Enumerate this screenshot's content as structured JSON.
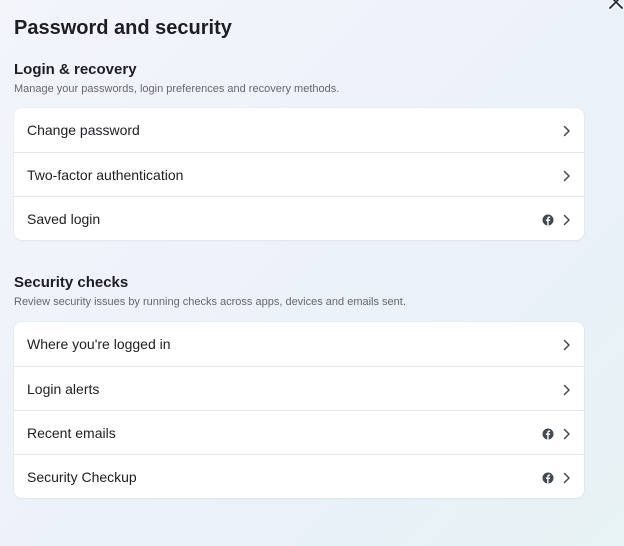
{
  "page": {
    "title": "Password and security"
  },
  "login_recovery": {
    "title": "Login & recovery",
    "description": "Manage your passwords, login preferences and recovery methods.",
    "items": [
      {
        "label": "Change password",
        "meta_icon": false
      },
      {
        "label": "Two-factor authentication",
        "meta_icon": false
      },
      {
        "label": "Saved login",
        "meta_icon": true
      }
    ]
  },
  "security_checks": {
    "title": "Security checks",
    "description": "Review security issues by running checks across apps, devices and emails sent.",
    "items": [
      {
        "label": "Where you're logged in",
        "meta_icon": false
      },
      {
        "label": "Login alerts",
        "meta_icon": false
      },
      {
        "label": "Recent emails",
        "meta_icon": true
      },
      {
        "label": "Security Checkup",
        "meta_icon": true
      }
    ]
  },
  "icons": {
    "close": "close-icon",
    "row_arrow": "chevron-right-icon",
    "platform": "facebook-icon"
  },
  "colors": {
    "text_primary": "#1c1e21",
    "text_secondary": "#65676b",
    "card_bg": "#ffffff",
    "divider": "#e4e6eb",
    "icon": "#444950"
  }
}
